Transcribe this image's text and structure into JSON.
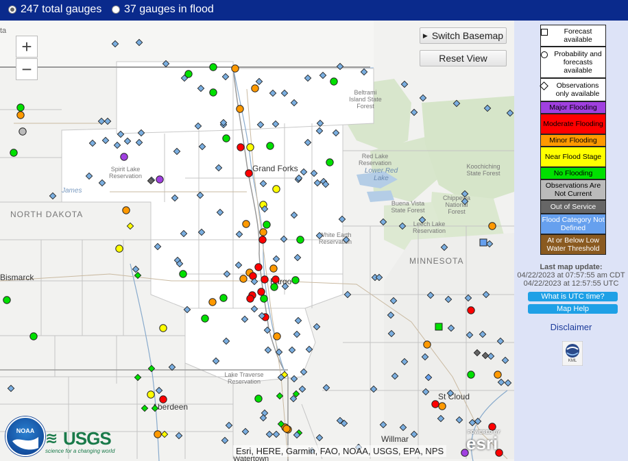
{
  "topbar": {
    "option_total": "247 total gauges",
    "option_flood": "37 gauges in flood",
    "selected": "total"
  },
  "map": {
    "zoom_in": "+",
    "zoom_out": "−",
    "switch_basemap": "Switch Basemap",
    "reset_view": "Reset View",
    "attribution": "Esri, HERE, Garmin, FAO, NOAA, USGS, EPA, NPS",
    "labels": {
      "north_dakota": "NORTH DAKOTA",
      "minnesota": "MINNESOTA",
      "grand_forks": "Grand Forks",
      "fargo": "Fargo",
      "bismarck": "Bismarck",
      "aberdeen": "Aberdeen",
      "st_cloud": "St Cloud",
      "willmar": "Willmar",
      "watertown": "Watertown",
      "james": "James",
      "spirit_lake": "Spirit Lake Reservation",
      "beltrami": "Beltrami Island State Forest",
      "red_lake_res": "Red Lake Reservation",
      "lower_red_lake": "Lower Red Lake",
      "buena_vista": "Buena Vista State Forest",
      "chippewa": "Chippewa National Forest",
      "leech_lake": "Leech Lake Reservation",
      "koochiching": "Koochiching State Forest",
      "white_earth": "White Earth Reservation",
      "lake_traverse": "Lake Traverse Reservation",
      "partial_top_left": "ta"
    },
    "logos": {
      "noaa": "NOAA",
      "usgs": "USGS",
      "usgs_tagline": "science for a changing world",
      "esri_powered": "POWERED BY",
      "esri": "esri"
    }
  },
  "legend": {
    "forecast": "Forecast available",
    "probability": "Probability and forecasts available",
    "observations": "Observations only available",
    "major": "Major Flooding",
    "moderate": "Moderate Flooding",
    "minor": "Minor Flooding",
    "near": "Near Flood Stage",
    "no_flood": "No Flooding",
    "not_current": "Observations Are Not Current",
    "out_of_service": "Out of Service",
    "not_defined": "Flood Category Not Defined",
    "low_water": "At or Below Low Water Threshold"
  },
  "colors": {
    "major": "#a040e0",
    "moderate": "#ff0000",
    "minor": "#ff9900",
    "near": "#ffff00",
    "no_flood": "#00e000",
    "not_current": "#bbbbbb",
    "out_of_service": "#666666",
    "not_defined": "#66a0ee",
    "low_water": "#8a5a20",
    "obs_diamond": "#7aaee0"
  },
  "side": {
    "last_update_label": "Last map update:",
    "time_local": "04/22/2023 at 07:57:55 am CDT",
    "time_utc": "04/22/2023 at 12:57:55 UTC",
    "utc_button": "What is UTC time?",
    "help_button": "Map Help",
    "disclaimer": "Disclaimer",
    "kml_label": "KML"
  }
}
